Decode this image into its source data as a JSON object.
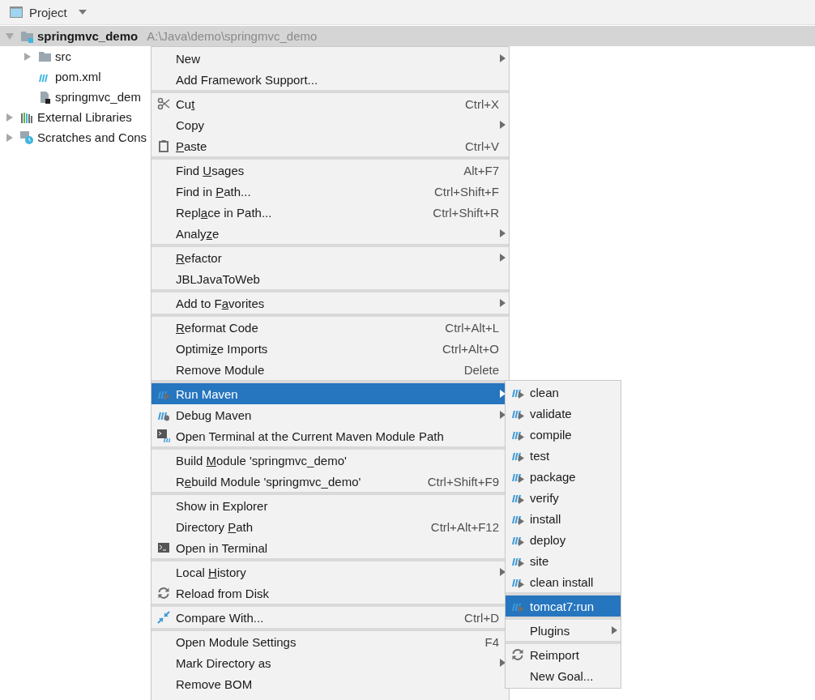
{
  "panel": {
    "title": "Project"
  },
  "tree": [
    {
      "label": "springmvc_demo",
      "path": "A:\\Java\\demo\\springmvc_demo",
      "kind": "module",
      "expanded": true,
      "selected": true,
      "children": [
        {
          "label": "src",
          "kind": "folder",
          "expanded": false,
          "selected": false
        },
        {
          "label": "pom.xml",
          "kind": "maven",
          "selected": false
        },
        {
          "label": "springmvc_dem",
          "kind": "file",
          "selected": false
        }
      ]
    },
    {
      "label": "External Libraries",
      "kind": "libraries",
      "expanded": false,
      "selected": false
    },
    {
      "label": "Scratches and Cons",
      "kind": "scratches",
      "expanded": false,
      "selected": false
    }
  ],
  "context_menu": {
    "groups": [
      {
        "items": [
          {
            "label": "New",
            "kind": "plain",
            "has_submenu": true,
            "selected": false
          },
          {
            "label": "Add Framework Support...",
            "kind": "plain",
            "has_submenu": false,
            "selected": false
          }
        ]
      },
      {
        "items": [
          {
            "before": "Cu",
            "mnemonic": "t",
            "kind": "scissors",
            "shortcut": "Ctrl+X",
            "has_submenu": false,
            "selected": false
          },
          {
            "label": "Copy",
            "kind": "plain",
            "has_submenu": true,
            "selected": false
          },
          {
            "mnemonic": "P",
            "after": "aste",
            "kind": "clipboard",
            "shortcut": "Ctrl+V",
            "has_submenu": false,
            "selected": false
          }
        ]
      },
      {
        "items": [
          {
            "before": "Find ",
            "mnemonic": "U",
            "after": "sages",
            "kind": "plain",
            "shortcut": "Alt+F7",
            "has_submenu": false,
            "selected": false
          },
          {
            "before": "Find in ",
            "mnemonic": "P",
            "after": "ath...",
            "kind": "plain",
            "shortcut": "Ctrl+Shift+F",
            "has_submenu": false,
            "selected": false
          },
          {
            "before": "Repl",
            "mnemonic": "a",
            "after": "ce in Path...",
            "kind": "plain",
            "shortcut": "Ctrl+Shift+R",
            "has_submenu": false,
            "selected": false
          },
          {
            "before": "Analy",
            "mnemonic": "z",
            "after": "e",
            "kind": "plain",
            "has_submenu": true,
            "selected": false
          }
        ]
      },
      {
        "items": [
          {
            "mnemonic": "R",
            "after": "efactor",
            "kind": "plain",
            "has_submenu": true,
            "selected": false
          },
          {
            "label": "JBLJavaToWeb",
            "kind": "plain",
            "has_submenu": false,
            "selected": false
          }
        ]
      },
      {
        "items": [
          {
            "before": "Add to F",
            "mnemonic": "a",
            "after": "vorites",
            "kind": "plain",
            "has_submenu": true,
            "selected": false
          }
        ]
      },
      {
        "items": [
          {
            "mnemonic": "R",
            "after": "eformat Code",
            "kind": "plain",
            "shortcut": "Ctrl+Alt+L",
            "has_submenu": false,
            "selected": false
          },
          {
            "before": "Optimi",
            "mnemonic": "z",
            "after": "e Imports",
            "kind": "plain",
            "shortcut": "Ctrl+Alt+O",
            "has_submenu": false,
            "selected": false
          },
          {
            "label": "Remove Module",
            "kind": "plain",
            "shortcut": "Delete",
            "has_submenu": false,
            "selected": false
          }
        ]
      },
      {
        "items": [
          {
            "label": "Run Maven",
            "kind": "maven-run",
            "has_submenu": true,
            "selected": true
          },
          {
            "label": "Debug Maven",
            "kind": "maven-debug",
            "has_submenu": true,
            "selected": false
          },
          {
            "label": "Open Terminal at the Current Maven Module Path",
            "kind": "terminal-maven",
            "has_submenu": false,
            "selected": false
          }
        ]
      },
      {
        "items": [
          {
            "before": "Build ",
            "mnemonic": "M",
            "after": "odule 'springmvc_demo'",
            "kind": "plain",
            "has_submenu": false,
            "selected": false
          },
          {
            "before": "R",
            "mnemonic": "e",
            "after": "build Module 'springmvc_demo'",
            "kind": "plain",
            "shortcut": "Ctrl+Shift+F9",
            "has_submenu": false,
            "selected": false
          }
        ]
      },
      {
        "items": [
          {
            "label": "Show in Explorer",
            "kind": "plain",
            "has_submenu": false,
            "selected": false
          },
          {
            "before": "Directory ",
            "mnemonic": "P",
            "after": "ath",
            "kind": "plain",
            "shortcut": "Ctrl+Alt+F12",
            "has_submenu": false,
            "selected": false
          },
          {
            "label": "Open in Terminal",
            "kind": "terminal",
            "has_submenu": false,
            "selected": false
          }
        ]
      },
      {
        "items": [
          {
            "before": "Local ",
            "mnemonic": "H",
            "after": "istory",
            "kind": "plain",
            "has_submenu": true,
            "selected": false
          },
          {
            "label": "Reload from Disk",
            "kind": "reload",
            "has_submenu": false,
            "selected": false
          }
        ]
      },
      {
        "items": [
          {
            "label": "Compare With...",
            "kind": "compare",
            "shortcut": "Ctrl+D",
            "has_submenu": false,
            "selected": false
          }
        ]
      },
      {
        "items": [
          {
            "label": "Open Module Settings",
            "kind": "plain",
            "shortcut": "F4",
            "has_submenu": false,
            "selected": false
          },
          {
            "label": "Mark Directory as",
            "kind": "plain",
            "has_submenu": true,
            "selected": false
          },
          {
            "label": "Remove BOM",
            "kind": "plain",
            "has_submenu": false,
            "selected": false
          }
        ]
      }
    ]
  },
  "submenu": {
    "groups": [
      {
        "items": [
          {
            "label": "clean",
            "kind": "maven-run",
            "has_submenu": false,
            "selected": false
          },
          {
            "label": "validate",
            "kind": "maven-run",
            "has_submenu": false,
            "selected": false
          },
          {
            "label": "compile",
            "kind": "maven-run",
            "has_submenu": false,
            "selected": false
          },
          {
            "label": "test",
            "kind": "maven-run",
            "has_submenu": false,
            "selected": false
          },
          {
            "label": "package",
            "kind": "maven-run",
            "has_submenu": false,
            "selected": false
          },
          {
            "label": "verify",
            "kind": "maven-run",
            "has_submenu": false,
            "selected": false
          },
          {
            "label": "install",
            "kind": "maven-run",
            "has_submenu": false,
            "selected": false
          },
          {
            "label": "deploy",
            "kind": "maven-run",
            "has_submenu": false,
            "selected": false
          },
          {
            "label": "site",
            "kind": "maven-run",
            "has_submenu": false,
            "selected": false
          },
          {
            "label": "clean install",
            "kind": "maven-run",
            "has_submenu": false,
            "selected": false
          }
        ]
      },
      {
        "items": [
          {
            "label": "tomcat7:run",
            "kind": "maven-run",
            "has_submenu": false,
            "selected": true
          }
        ]
      },
      {
        "items": [
          {
            "label": "Plugins",
            "kind": "plain",
            "has_submenu": true,
            "selected": false
          }
        ]
      },
      {
        "items": [
          {
            "label": "Reimport",
            "kind": "reload",
            "has_submenu": false,
            "selected": false
          },
          {
            "label": "New Goal...",
            "kind": "plain",
            "has_submenu": false,
            "selected": false
          }
        ]
      }
    ]
  }
}
